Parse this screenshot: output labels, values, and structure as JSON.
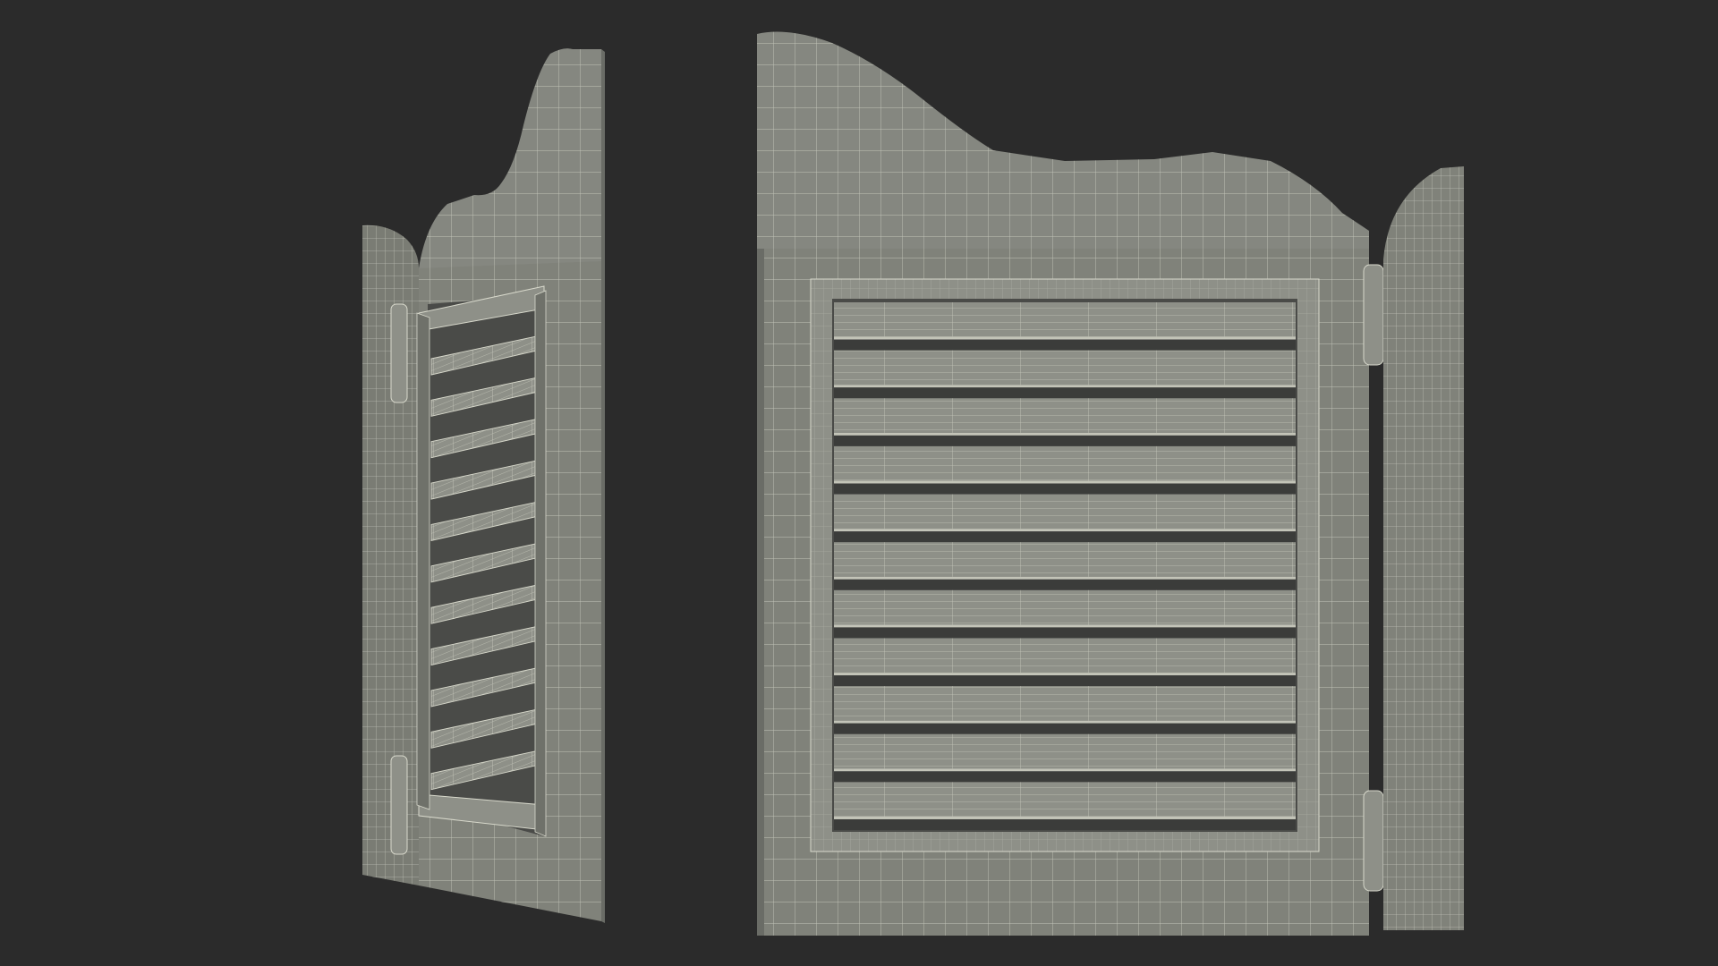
{
  "scene": {
    "background": "#2b2b2b",
    "material": {
      "fill": "#80827a",
      "fill_dark": "#6a6c66",
      "fill_light": "#8e9088",
      "wire": "#d8d9cc",
      "shadow": "#3b3c3a"
    },
    "views": [
      {
        "name": "side-view",
        "louver_count": 11,
        "hinge_count": 2
      },
      {
        "name": "front-view",
        "louver_count": 11,
        "hinge_count": 2
      }
    ]
  }
}
